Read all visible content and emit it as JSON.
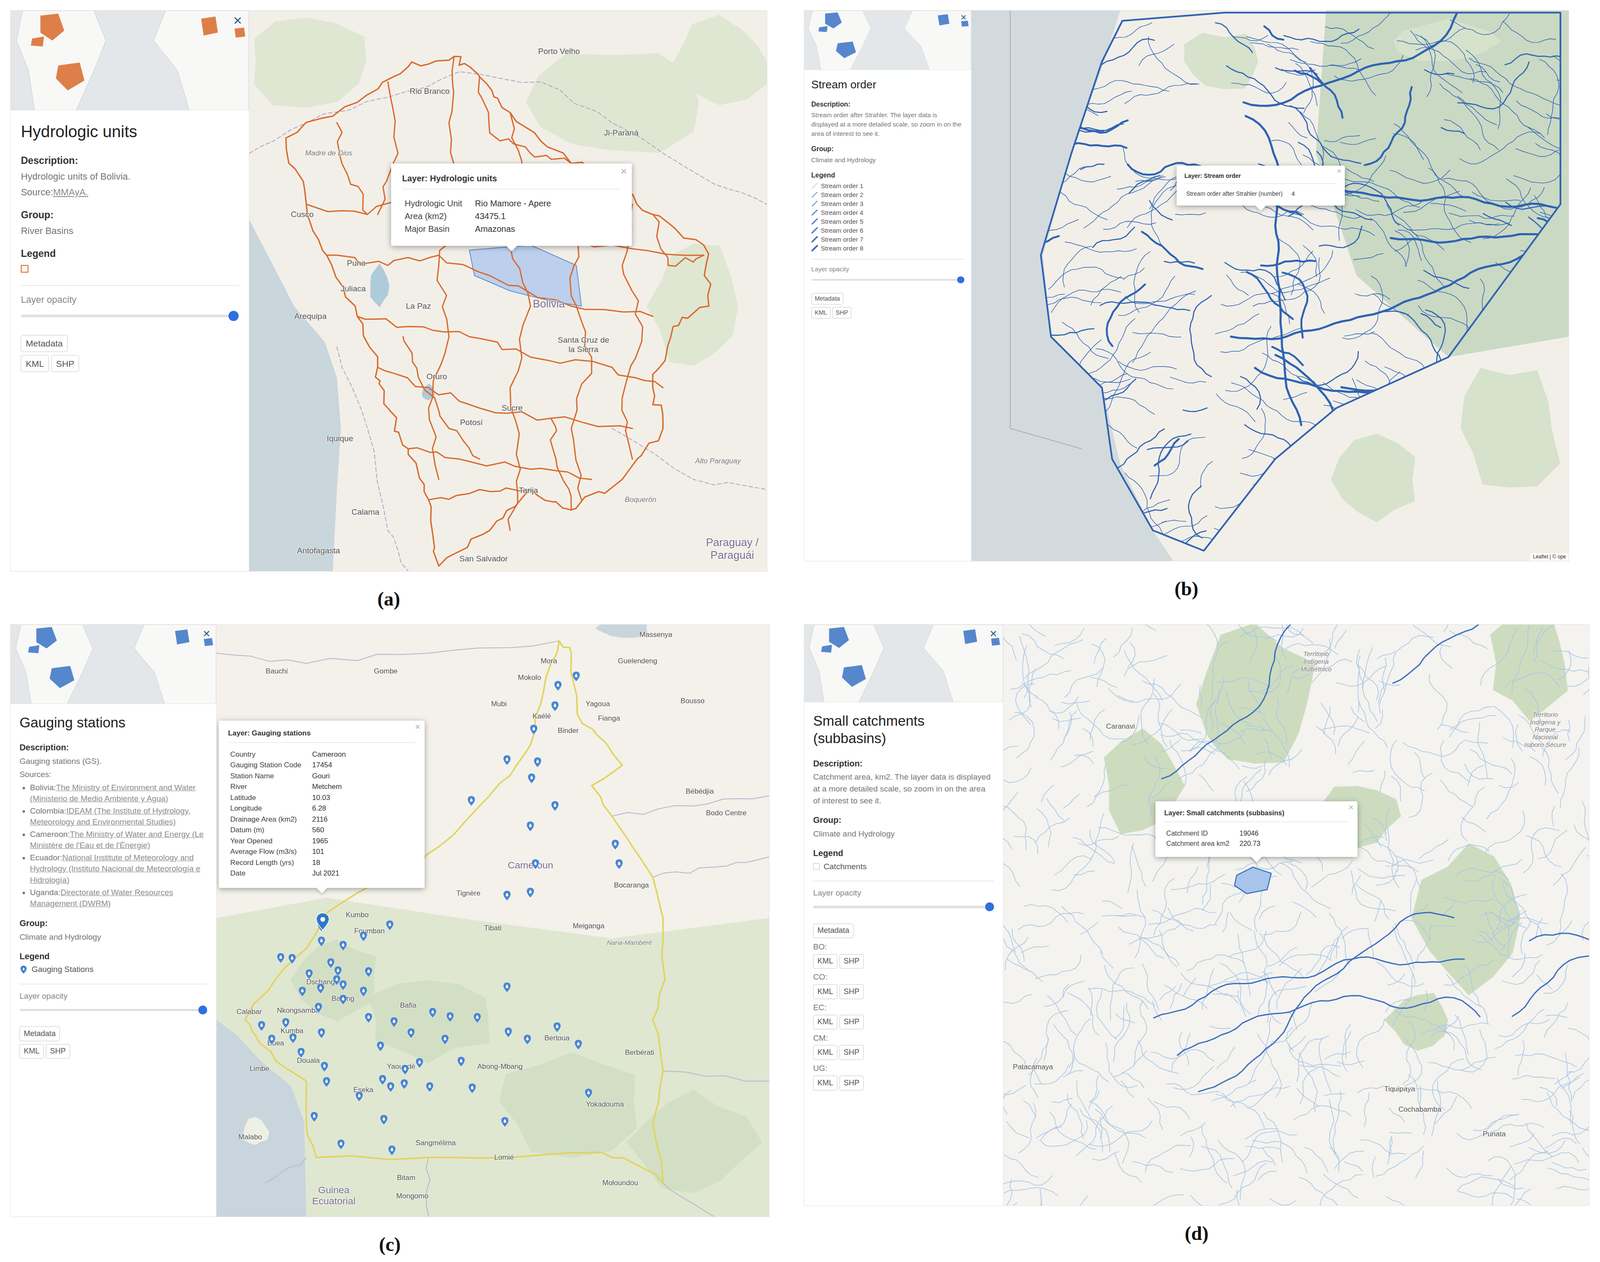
{
  "panels": [
    {
      "kind": "units",
      "caption": "(a)",
      "sidebar": {
        "close": "×",
        "title": "Hydrologic units",
        "description_label": "Description:",
        "description": "Hydrologic units of Bolivia.",
        "source": {
          "prefix": "Source:",
          "link": "MMAyA."
        },
        "group_label": "Group:",
        "group": "River Basins",
        "legend_label": "Legend",
        "legend": [
          {
            "kind": "square"
          }
        ],
        "opacity": {
          "label": "Layer opacity",
          "level": 1
        },
        "metadata": "Metadata",
        "downloads": [
          {
            "buttons": [
              "KML",
              "SHP"
            ]
          }
        ]
      },
      "map": {
        "labels": [
          {
            "text": "Porto Velho",
            "kind": "city"
          },
          {
            "text": "Rio Branco",
            "kind": "city"
          },
          {
            "text": "Ji-Paraná",
            "kind": "city"
          },
          {
            "text": "Madre de Dios",
            "kind": "region"
          },
          {
            "text": "Cusco",
            "kind": "city"
          },
          {
            "text": "Puno",
            "kind": "city"
          },
          {
            "text": "Juliaca",
            "kind": "city"
          },
          {
            "text": "Arequipa",
            "kind": "city"
          },
          {
            "text": "La Paz",
            "kind": "city"
          },
          {
            "text": "Bolivia",
            "kind": "country"
          },
          {
            "text": "Santa Cruz de la Sierra",
            "kind": "city"
          },
          {
            "text": "Oruro",
            "kind": "city"
          },
          {
            "text": "Sucre",
            "kind": "city"
          },
          {
            "text": "Potosí",
            "kind": "city"
          },
          {
            "text": "Iquique",
            "kind": "city"
          },
          {
            "text": "Tarija",
            "kind": "city"
          },
          {
            "text": "Alto Paraguay",
            "kind": "region"
          },
          {
            "text": "Boquerón",
            "kind": "region"
          },
          {
            "text": "Calama",
            "kind": "city"
          },
          {
            "text": "Antofagasta",
            "kind": "city"
          },
          {
            "text": "Paraguay / Paraguái",
            "kind": "country"
          },
          {
            "text": "San Salvador",
            "kind": "city"
          }
        ],
        "popup": {
          "title": "Layer: Hydrologic units",
          "close": "×",
          "rows": [
            {
              "key": "Hydrologic Unit",
              "value": "Rio Mamore - Apere"
            },
            {
              "key": "Area (km2)",
              "value": "43475.1"
            },
            {
              "key": "Major Basin",
              "value": "Amazonas"
            }
          ]
        }
      }
    },
    {
      "kind": "streams",
      "caption": "(b)",
      "sidebar": {
        "close": "×",
        "title": "Stream order",
        "description_label": "Description:",
        "description": "Stream order after Strahler. The layer data is displayed at a more detailed scale, so zoom in on the area of interest to see it.",
        "group_label": "Group:",
        "group": "Climate and Hydrology",
        "legend_label": "Legend",
        "legend": [
          {
            "kind": "line",
            "label": "Stream order 1"
          },
          {
            "kind": "line",
            "label": "Stream order 2"
          },
          {
            "kind": "line",
            "label": "Stream order 3"
          },
          {
            "kind": "line",
            "label": "Stream order 4"
          },
          {
            "kind": "line",
            "label": "Stream order 5"
          },
          {
            "kind": "line",
            "label": "Stream order 6"
          },
          {
            "kind": "line",
            "label": "Stream order 7"
          },
          {
            "kind": "line",
            "label": "Stream order 8"
          }
        ],
        "opacity": {
          "label": "Layer opacity",
          "level": 1
        },
        "metadata": "Metadata",
        "downloads": [
          {
            "buttons": [
              "KML",
              "SHP"
            ]
          }
        ]
      },
      "map": {
        "labels": [],
        "attribution": "Leaflet | © ope",
        "popup": {
          "title": "Layer: Stream order",
          "close": "×",
          "rows": [
            {
              "key": "Stream order after Strahler (number)",
              "value": "4"
            }
          ]
        }
      }
    },
    {
      "kind": "stations",
      "caption": "(c)",
      "sidebar": {
        "close": "×",
        "title": "Gauging stations",
        "description_label": "Description:",
        "description": "Gauging stations (GS).",
        "sources": {
          "label": "Sources:",
          "items": [
            {
              "country": "Bolivia:",
              "org": "The Ministry of Environment and Water (Ministerio de Medio Ambiente y Agua)"
            },
            {
              "country": "Colombia:",
              "org": "IDEAM (The Institute of Hydrology, Meteorology and Environmental Studies)"
            },
            {
              "country": "Cameroon:",
              "org": "The Ministry of Water and Energy (Le Ministère de l'Eau et de l'Énergie)"
            },
            {
              "country": "Ecuador:",
              "org": "National Institute of Meteorology and Hydrology (Instituto Nacional de Meteorología e Hidrología)"
            },
            {
              "country": "Uganda:",
              "org": "Directorate of Water Resources Management (DWRM)"
            }
          ]
        },
        "group_label": "Group:",
        "group": "Climate and Hydrology",
        "legend_label": "Legend",
        "legend": [
          {
            "kind": "drop",
            "label": "Gauging Stations"
          }
        ],
        "opacity": {
          "label": "Layer opacity",
          "level": 1
        },
        "metadata": "Metadata",
        "downloads": [
          {
            "buttons": [
              "KML",
              "SHP"
            ]
          }
        ]
      },
      "map": {
        "labels": [
          {
            "text": "Bauchi",
            "kind": "city"
          },
          {
            "text": "Gombe",
            "kind": "city"
          },
          {
            "text": "Mora",
            "kind": "city"
          },
          {
            "text": "Mokolo",
            "kind": "city"
          },
          {
            "text": "Mubi",
            "kind": "city"
          },
          {
            "text": "Kaélé",
            "kind": "city"
          },
          {
            "text": "Yagoua",
            "kind": "city"
          },
          {
            "text": "Binder",
            "kind": "city"
          },
          {
            "text": "Fianga",
            "kind": "city"
          },
          {
            "text": "Guelendeng",
            "kind": "city"
          },
          {
            "text": "Massenya",
            "kind": "city"
          },
          {
            "text": "Bousso",
            "kind": "city"
          },
          {
            "text": "Bébédjia",
            "kind": "city"
          },
          {
            "text": "Bodo Centre",
            "kind": "city"
          },
          {
            "text": "Cameroun",
            "kind": "country"
          },
          {
            "text": "Tignère",
            "kind": "city"
          },
          {
            "text": "Tibati",
            "kind": "city"
          },
          {
            "text": "Meiganga",
            "kind": "city"
          },
          {
            "text": "Bocaranga",
            "kind": "city"
          },
          {
            "text": "Nana-Mambéré",
            "kind": "region"
          },
          {
            "text": "Kumbo",
            "kind": "city"
          },
          {
            "text": "Foumban",
            "kind": "city"
          },
          {
            "text": "Dschang",
            "kind": "city"
          },
          {
            "text": "Bafang",
            "kind": "city"
          },
          {
            "text": "Nkongsamba",
            "kind": "city"
          },
          {
            "text": "Calabar",
            "kind": "city"
          },
          {
            "text": "Kumba",
            "kind": "city"
          },
          {
            "text": "Buea",
            "kind": "city"
          },
          {
            "text": "Douala",
            "kind": "city"
          },
          {
            "text": "Limbe",
            "kind": "city"
          },
          {
            "text": "Bafia",
            "kind": "city"
          },
          {
            "text": "Yaoundé",
            "kind": "city"
          },
          {
            "text": "Abong-Mbang",
            "kind": "city"
          },
          {
            "text": "Bertoua",
            "kind": "city"
          },
          {
            "text": "Berbérati",
            "kind": "city"
          },
          {
            "text": "Eseka",
            "kind": "city"
          },
          {
            "text": "Yokadouma",
            "kind": "city"
          },
          {
            "text": "Malabo",
            "kind": "city"
          },
          {
            "text": "Sangmélima",
            "kind": "city"
          },
          {
            "text": "Lomié",
            "kind": "city"
          },
          {
            "text": "Bitam",
            "kind": "city"
          },
          {
            "text": "Guinea Ecuatorial",
            "kind": "country"
          },
          {
            "text": "Mongomo",
            "kind": "city"
          },
          {
            "text": "Moloundou",
            "kind": "city"
          }
        ],
        "markers": [
          {
            "selected": false
          },
          {
            "selected": false
          },
          {
            "selected": false
          },
          {
            "selected": false
          },
          {
            "selected": false
          },
          {
            "selected": false
          },
          {
            "selected": false
          },
          {
            "selected": false
          },
          {
            "selected": false
          },
          {
            "selected": false
          },
          {
            "selected": false
          },
          {
            "selected": false
          },
          {
            "selected": false
          },
          {
            "selected": false
          },
          {
            "selected": false
          },
          {
            "selected": true
          },
          {
            "selected": false
          },
          {
            "selected": false
          },
          {
            "selected": false
          },
          {
            "selected": false
          },
          {
            "selected": false
          },
          {
            "selected": false
          },
          {
            "selected": false
          },
          {
            "selected": false
          },
          {
            "selected": false
          },
          {
            "selected": false
          },
          {
            "selected": false
          },
          {
            "selected": false
          },
          {
            "selected": false
          },
          {
            "selected": false
          },
          {
            "selected": false
          },
          {
            "selected": false
          },
          {
            "selected": false
          },
          {
            "selected": false
          },
          {
            "selected": false
          },
          {
            "selected": false
          },
          {
            "selected": false
          },
          {
            "selected": false
          },
          {
            "selected": false
          },
          {
            "selected": false
          },
          {
            "selected": false
          },
          {
            "selected": false
          },
          {
            "selected": false
          },
          {
            "selected": false
          },
          {
            "selected": false
          },
          {
            "selected": false
          },
          {
            "selected": false
          },
          {
            "selected": false
          },
          {
            "selected": false
          },
          {
            "selected": false
          },
          {
            "selected": false
          },
          {
            "selected": false
          },
          {
            "selected": false
          },
          {
            "selected": false
          },
          {
            "selected": false
          },
          {
            "selected": false
          },
          {
            "selected": false
          },
          {
            "selected": false
          },
          {
            "selected": false
          },
          {
            "selected": false
          },
          {
            "selected": false
          },
          {
            "selected": false
          },
          {
            "selected": false
          },
          {
            "selected": false
          },
          {
            "selected": false
          },
          {
            "selected": false
          },
          {
            "selected": false
          },
          {
            "selected": false
          },
          {
            "selected": false
          },
          {
            "selected": false
          }
        ],
        "popup": {
          "title": "Layer: Gauging stations",
          "close": "×",
          "rows": [
            {
              "key": "Country",
              "value": "Cameroon"
            },
            {
              "key": "Gauging Station Code",
              "value": "17454"
            },
            {
              "key": "Station Name",
              "value": "Gouri"
            },
            {
              "key": "River",
              "value": "Metchem"
            },
            {
              "key": "Latitude",
              "value": "10.03"
            },
            {
              "key": "Longitude",
              "value": "6.28"
            },
            {
              "key": "Drainage Area (km2)",
              "value": "2116"
            },
            {
              "key": "Datum (m)",
              "value": "560"
            },
            {
              "key": "Year Opened",
              "value": "1965"
            },
            {
              "key": "Average Flow (m3/s)",
              "value": "101"
            },
            {
              "key": "Record Length (yrs)",
              "value": "18"
            },
            {
              "key": "Date",
              "value": "Jul 2021"
            }
          ]
        }
      }
    },
    {
      "kind": "catchments",
      "caption": "(d)",
      "sidebar": {
        "close": "×",
        "title": "Small catchments (subbasins)",
        "description_label": "Description:",
        "description": "Catchment area, km2. The layer data is displayed at a more detailed scale, so zoom in on the area of interest to see it.",
        "group_label": "Group:",
        "group": "Climate and Hydrology",
        "legend_label": "Legend",
        "legend": [
          {
            "kind": "box",
            "label": "Catchments"
          }
        ],
        "opacity": {
          "label": "Layer opacity",
          "level": 1
        },
        "metadata": "Metadata",
        "downloads": [
          {
            "label": "BO:",
            "buttons": [
              "KML",
              "SHP"
            ]
          },
          {
            "label": "CO:",
            "buttons": [
              "KML",
              "SHP"
            ]
          },
          {
            "label": "EC:",
            "buttons": [
              "KML",
              "SHP"
            ]
          },
          {
            "label": "CM:",
            "buttons": [
              "KML",
              "SHP"
            ]
          },
          {
            "label": "UG:",
            "buttons": [
              "KML",
              "SHP"
            ]
          }
        ]
      },
      "map": {
        "labels": [
          {
            "text": "Territorio Indígena Multiétnico",
            "kind": "region"
          },
          {
            "text": "Caranavi",
            "kind": "city"
          },
          {
            "text": "Territorio Indígena y Parque Nacional Isiboro Sécure",
            "kind": "region"
          },
          {
            "text": "Patacamaya",
            "kind": "city"
          },
          {
            "text": "Tiquipaya",
            "kind": "city"
          },
          {
            "text": "Cochabamba",
            "kind": "city"
          },
          {
            "text": "Punata",
            "kind": "city"
          }
        ],
        "popup": {
          "title": "Layer: Small catchments (subbasins)",
          "close": "×",
          "rows": [
            {
              "key": "Catchment ID",
              "value": "19046"
            },
            {
              "key": "Catchment area km2",
              "value": "220.73"
            }
          ]
        }
      }
    }
  ]
}
